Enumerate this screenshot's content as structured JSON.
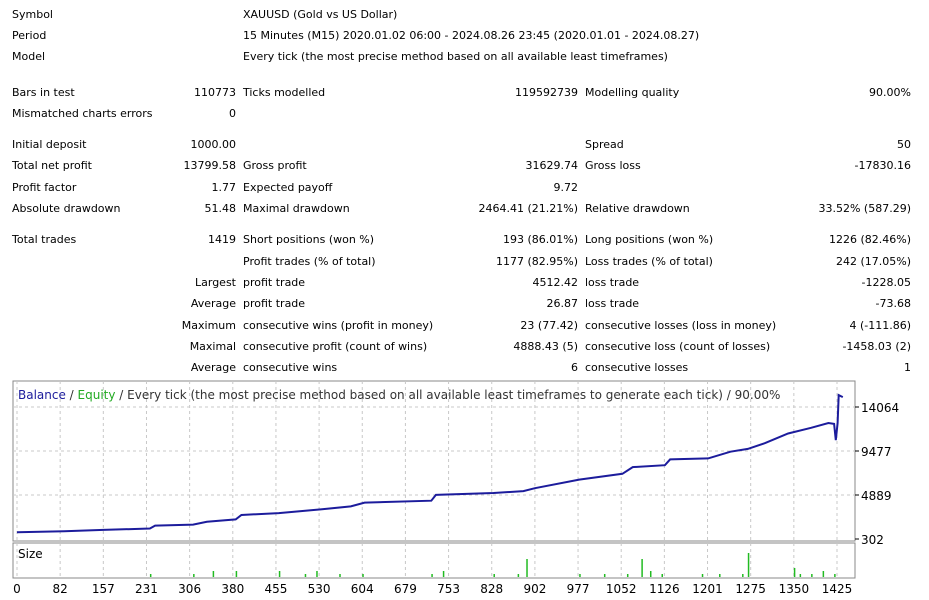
{
  "header_rows": [
    {
      "label": "Symbol",
      "value": "XAUUSD (Gold vs US Dollar)"
    },
    {
      "label": "Period",
      "value": "15 Minutes (M15) 2020.01.02 06:00 - 2024.08.26 23:45 (2020.01.01 - 2024.08.27)"
    },
    {
      "label": "Model",
      "value": "Every tick (the most precise method based on all available least timeframes)"
    }
  ],
  "stats_rows": [
    [
      "Bars in test",
      "110773",
      "Ticks modelled",
      "119592739",
      "Modelling quality",
      "90.00%"
    ],
    [
      "Mismatched charts errors",
      "0",
      "",
      "",
      "",
      ""
    ],
    [
      "Initial deposit",
      "1000.00",
      "",
      "",
      "Spread",
      "50"
    ],
    [
      "Total net profit",
      "13799.58",
      "Gross profit",
      "31629.74",
      "Gross loss",
      "-17830.16"
    ],
    [
      "Profit factor",
      "1.77",
      "Expected payoff",
      "9.72",
      "",
      ""
    ],
    [
      "Absolute drawdown",
      "51.48",
      "Maximal drawdown",
      "2464.41 (21.21%)",
      "Relative drawdown",
      "33.52% (587.29)"
    ],
    [
      "Total trades",
      "1419",
      "Short positions (won %)",
      "193 (86.01%)",
      "Long positions (won %)",
      "1226 (82.46%)"
    ],
    [
      "",
      "",
      "Profit trades (% of total)",
      "1177 (82.95%)",
      "Loss trades (% of total)",
      "242 (17.05%)"
    ],
    [
      "",
      "Largest",
      "profit trade",
      "4512.42",
      "loss trade",
      "-1228.05"
    ],
    [
      "",
      "Average",
      "profit trade",
      "26.87",
      "loss trade",
      "-73.68"
    ],
    [
      "",
      "Maximum",
      "consecutive wins (profit in money)",
      "23 (77.42)",
      "consecutive losses (loss in money)",
      "4 (-111.86)"
    ],
    [
      "",
      "Maximal",
      "consecutive profit (count of wins)",
      "4888.43 (5)",
      "consecutive loss (count of losses)",
      "-1458.03 (2)"
    ],
    [
      "",
      "Average",
      "consecutive wins",
      "6",
      "consecutive losses",
      "1"
    ]
  ],
  "chart_data": {
    "type": "line",
    "legend": {
      "balance": "Balance",
      "equity": "Equity",
      "separator": " / ",
      "description": " / Every tick (the most precise method based on all available least timeframes to generate each tick) / 90.00%"
    },
    "colors": {
      "balance": "#1c1c9c",
      "equity": "#22aa22",
      "size": "#22bb22",
      "grid": "#c8c8c8",
      "frame": "#888888"
    },
    "y_ticks": [
      "14064",
      "9477",
      "4889",
      "302"
    ],
    "x_ticks": [
      "0",
      "82",
      "157",
      "231",
      "306",
      "380",
      "455",
      "530",
      "604",
      "679",
      "753",
      "828",
      "902",
      "977",
      "1052",
      "1126",
      "1201",
      "1275",
      "1350",
      "1425"
    ],
    "ylim": [
      302,
      16700
    ],
    "xlim": [
      0,
      1440
    ],
    "size_label": "Size",
    "balance": [
      [
        0,
        1000
      ],
      [
        82,
        1100
      ],
      [
        150,
        1250
      ],
      [
        231,
        1400
      ],
      [
        240,
        1700
      ],
      [
        306,
        1800
      ],
      [
        330,
        2100
      ],
      [
        380,
        2350
      ],
      [
        390,
        2800
      ],
      [
        455,
        3000
      ],
      [
        530,
        3400
      ],
      [
        580,
        3700
      ],
      [
        604,
        4100
      ],
      [
        720,
        4300
      ],
      [
        728,
        4900
      ],
      [
        828,
        5100
      ],
      [
        880,
        5300
      ],
      [
        900,
        5600
      ],
      [
        977,
        6500
      ],
      [
        1052,
        7100
      ],
      [
        1070,
        7800
      ],
      [
        1126,
        8000
      ],
      [
        1135,
        8600
      ],
      [
        1201,
        8700
      ],
      [
        1240,
        9400
      ],
      [
        1270,
        9700
      ],
      [
        1300,
        10300
      ],
      [
        1340,
        11300
      ],
      [
        1380,
        11900
      ],
      [
        1410,
        12400
      ],
      [
        1420,
        12300
      ],
      [
        1423,
        10600
      ],
      [
        1426,
        12400
      ],
      [
        1428,
        15300
      ],
      [
        1435,
        15100
      ]
    ],
    "size_spikes": [
      [
        231,
        1
      ],
      [
        306,
        1
      ],
      [
        340,
        2
      ],
      [
        380,
        2
      ],
      [
        455,
        2
      ],
      [
        500,
        1
      ],
      [
        520,
        2
      ],
      [
        560,
        1
      ],
      [
        600,
        1
      ],
      [
        720,
        1
      ],
      [
        740,
        2
      ],
      [
        828,
        1
      ],
      [
        870,
        1
      ],
      [
        885,
        6
      ],
      [
        977,
        1
      ],
      [
        1020,
        1
      ],
      [
        1060,
        1
      ],
      [
        1085,
        6
      ],
      [
        1100,
        2
      ],
      [
        1120,
        1
      ],
      [
        1190,
        1
      ],
      [
        1220,
        1
      ],
      [
        1260,
        1
      ],
      [
        1270,
        8
      ],
      [
        1350,
        3
      ],
      [
        1360,
        1
      ],
      [
        1380,
        1
      ],
      [
        1400,
        2
      ],
      [
        1420,
        1
      ]
    ]
  }
}
